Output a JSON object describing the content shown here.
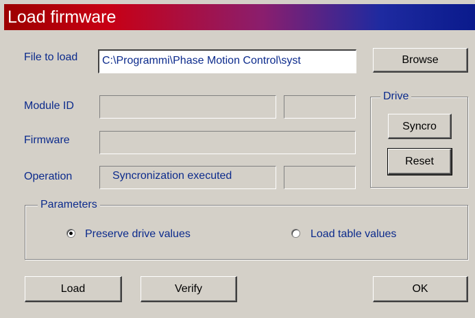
{
  "window": {
    "title": "Load firmware"
  },
  "file": {
    "label": "File to load",
    "value": "C:\\Programmi\\Phase Motion Control\\syst"
  },
  "browse_label": "Browse",
  "module": {
    "label": "Module ID",
    "value1": "",
    "value2": ""
  },
  "firmware": {
    "label": "Firmware",
    "value": ""
  },
  "operation": {
    "label": "Operation",
    "value": "Syncronization executed",
    "value2": ""
  },
  "drive": {
    "legend": "Drive",
    "syncro_label": "Syncro",
    "reset_label": "Reset"
  },
  "parameters": {
    "legend": "Parameters",
    "preserve_label": "Preserve drive values",
    "load_table_label": "Load table values",
    "selected": "preserve"
  },
  "buttons": {
    "load": "Load",
    "verify": "Verify",
    "ok": "OK"
  }
}
